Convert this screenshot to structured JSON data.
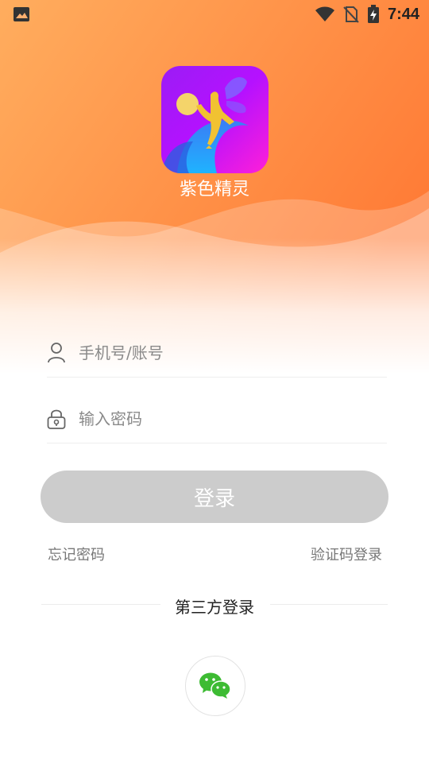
{
  "status_bar": {
    "time": "7:44",
    "icons": [
      "image-icon",
      "wifi-icon",
      "no-sim-icon",
      "battery-charging-icon"
    ]
  },
  "app": {
    "name": "紫色精灵",
    "icon": "fairy-app-icon"
  },
  "form": {
    "account": {
      "placeholder": "手机号/账号",
      "value": "",
      "icon": "user-icon"
    },
    "password": {
      "placeholder": "输入密码",
      "value": "",
      "icon": "lock-icon"
    }
  },
  "buttons": {
    "login": "登录",
    "forgot_password": "忘记密码",
    "code_login": "验证码登录"
  },
  "third_party": {
    "title": "第三方登录",
    "providers": [
      {
        "name": "wechat",
        "icon": "wechat-icon"
      }
    ]
  },
  "colors": {
    "orange_top": "#ff9a4a",
    "orange_deep": "#ff7a33",
    "button_disabled": "#cccccc",
    "wechat_green": "#3dbb33",
    "icon_purple": "#a017ff"
  }
}
